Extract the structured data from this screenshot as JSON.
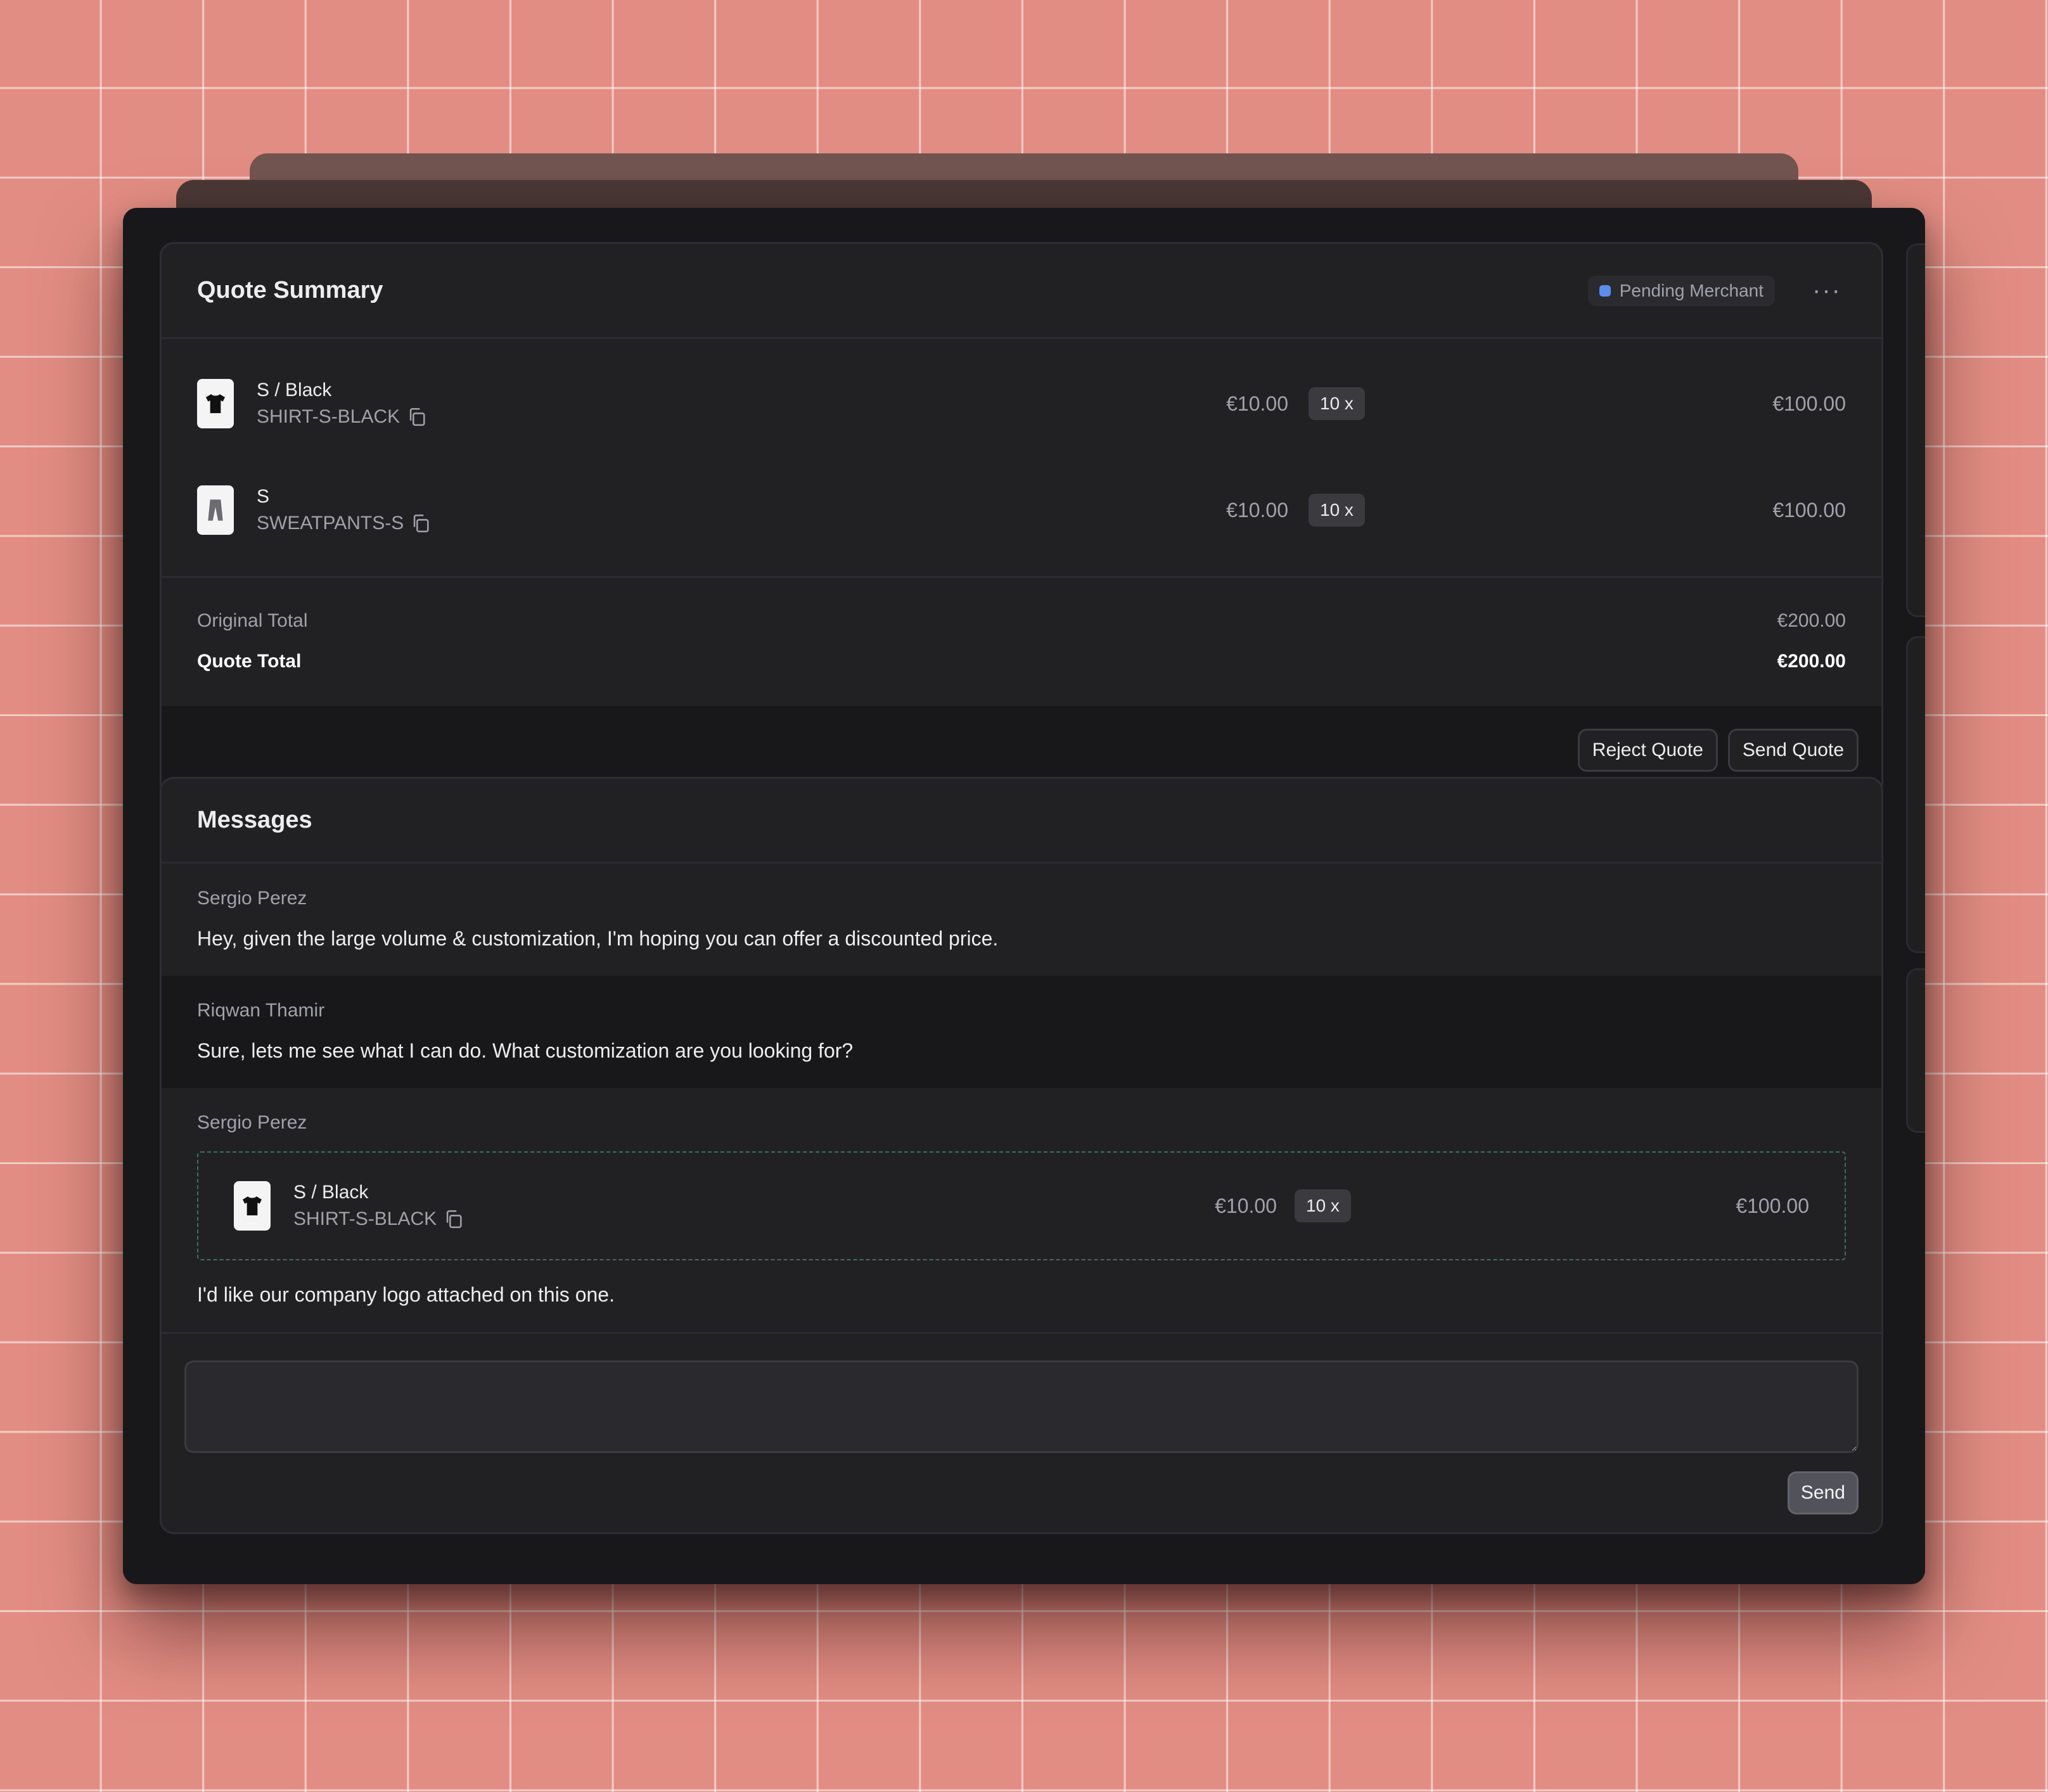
{
  "quote": {
    "title": "Quote Summary",
    "status_label": "Pending Merchant",
    "status_color": "#5b8def",
    "more_icon": "more-horizontal-icon",
    "items": [
      {
        "variant": "S / Black",
        "sku": "SHIRT-S-BLACK",
        "icon": "tshirt-icon",
        "unit_price": "€10.00",
        "quantity": "10 x",
        "total": "€100.00"
      },
      {
        "variant": "S",
        "sku": "SWEATPANTS-S",
        "icon": "sweatpants-icon",
        "unit_price": "€10.00",
        "quantity": "10 x",
        "total": "€100.00"
      }
    ],
    "original_total_label": "Original Total",
    "original_total_value": "€200.00",
    "quote_total_label": "Quote Total",
    "quote_total_value": "€200.00",
    "reject_label": "Reject Quote",
    "send_label": "Send Quote"
  },
  "messages": {
    "title": "Messages",
    "thread": [
      {
        "author": "Sergio Perez",
        "text": "Hey, given the large volume & customization, I'm hoping you can offer a discounted price."
      },
      {
        "author": "Riqwan Thamir",
        "text": "Sure, lets me see what I can do. What customization are you looking for?"
      },
      {
        "author": "Sergio Perez",
        "attachment": {
          "variant": "S / Black",
          "sku": "SHIRT-S-BLACK",
          "icon": "tshirt-icon",
          "unit_price": "€10.00",
          "quantity": "10 x",
          "total": "€100.00"
        },
        "text": "I'd like our company logo attached on this one."
      }
    ],
    "input_value": "",
    "send_label": "Send"
  }
}
